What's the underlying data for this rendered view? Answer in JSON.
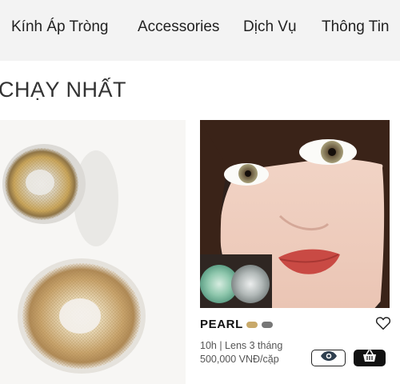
{
  "nav": {
    "items": [
      {
        "label": "Kính Áp Tròng"
      },
      {
        "label": "Accessories"
      },
      {
        "label": "Dịch Vụ"
      },
      {
        "label": "Thông Tin"
      }
    ]
  },
  "section": {
    "title": "CHẠY NHẤT"
  },
  "product": {
    "name": "PEARL",
    "colors": [
      "#c8a96a",
      "#777777"
    ],
    "duration": "10h | Lens 3 tháng",
    "price": "500,000 VNĐ/cặp",
    "icons": {
      "wishlist": "heart-icon",
      "quick_view": "eye-icon",
      "add_to_cart": "basket-icon"
    }
  }
}
